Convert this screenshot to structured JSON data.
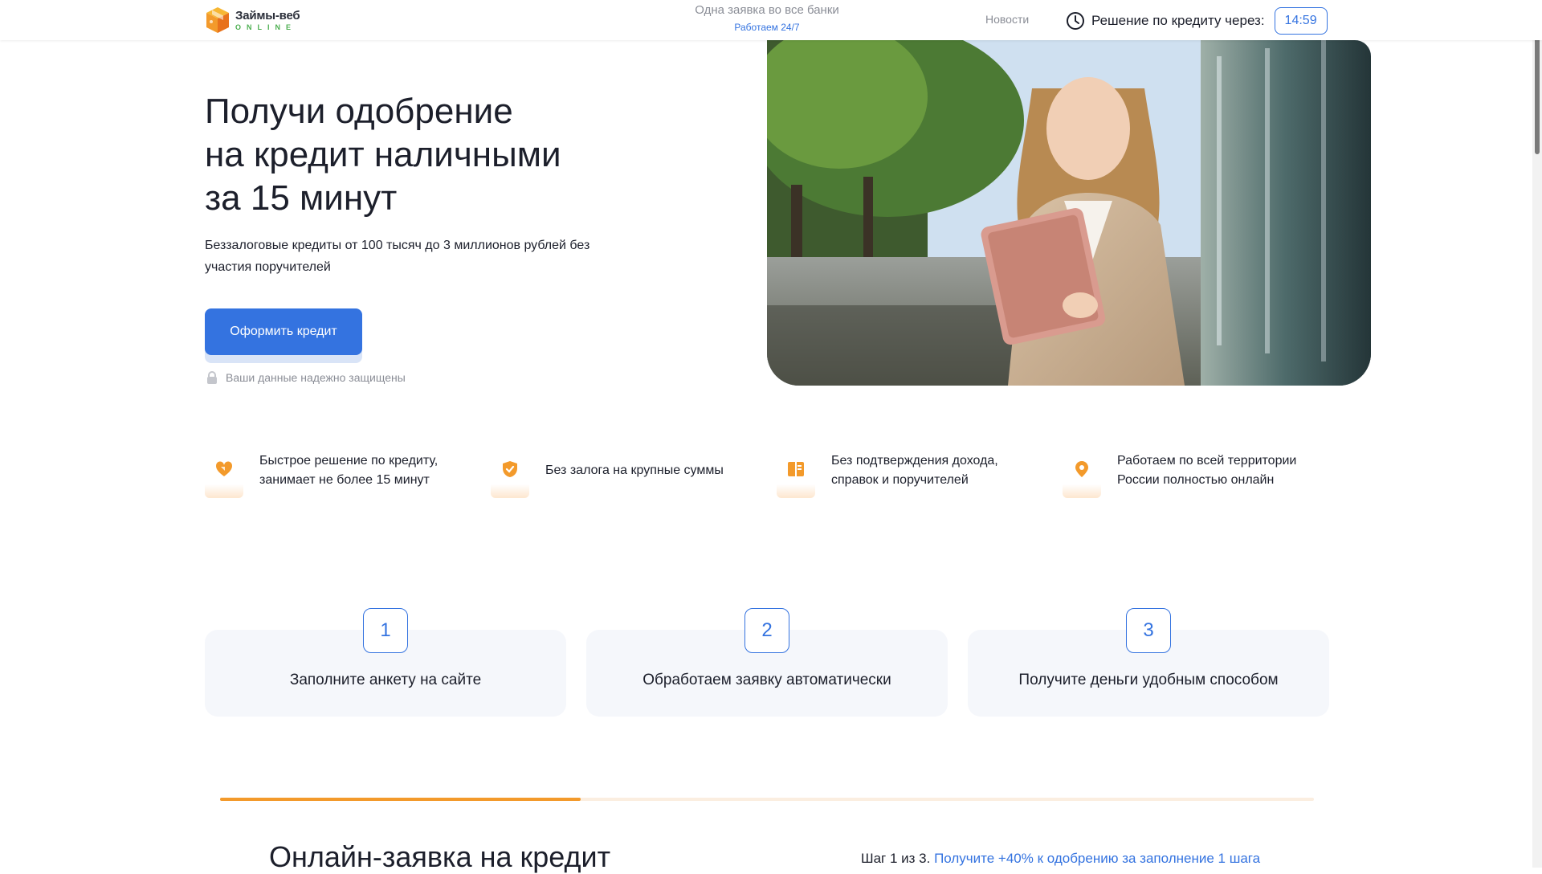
{
  "header": {
    "logo_name": "Займы-веб",
    "logo_sub": "ONLINE",
    "tagline_main": "Одна заявка во все банки",
    "tagline_sub": "Работаем 24/7",
    "nav_news": "Новости",
    "decision_label": "Решение по кредиту через:",
    "timer": "14:59"
  },
  "hero": {
    "title_line1": "Получи одобрение",
    "title_line2": "на кредит наличными",
    "title_line3": "за 15 минут",
    "description": "Беззалоговые кредиты от 100 тысяч до 3 миллионов рублей без участия поручителей",
    "cta_label": "Оформить кредит",
    "secure_note": "Ваши данные надежно защищены"
  },
  "features": [
    {
      "icon": "heart-tag-icon",
      "text": "Быстрое решение по кредиту, занимает не более 15 минут"
    },
    {
      "icon": "shield-check-icon",
      "text": "Без залога на крупные суммы"
    },
    {
      "icon": "document-icon",
      "text": "Без подтверждения дохода, справок и поручителей"
    },
    {
      "icon": "location-pin-icon",
      "text": "Работаем по всей территории России полностью онлайн"
    }
  ],
  "steps": [
    {
      "number": "1",
      "label": "Заполните анкету на сайте"
    },
    {
      "number": "2",
      "label": "Обработаем заявку автоматически"
    },
    {
      "number": "3",
      "label": "Получите деньги удобным способом"
    }
  ],
  "form": {
    "progress_fraction": 0.33,
    "title": "Онлайн-заявка на кредит",
    "step_counter": "Шаг 1 из 3.",
    "step_hint": "Получите +40% к одобрению за заполнение 1 шага"
  },
  "colors": {
    "accent": "#3473e0",
    "orange": "#f39a2b",
    "green": "#4caf50"
  }
}
